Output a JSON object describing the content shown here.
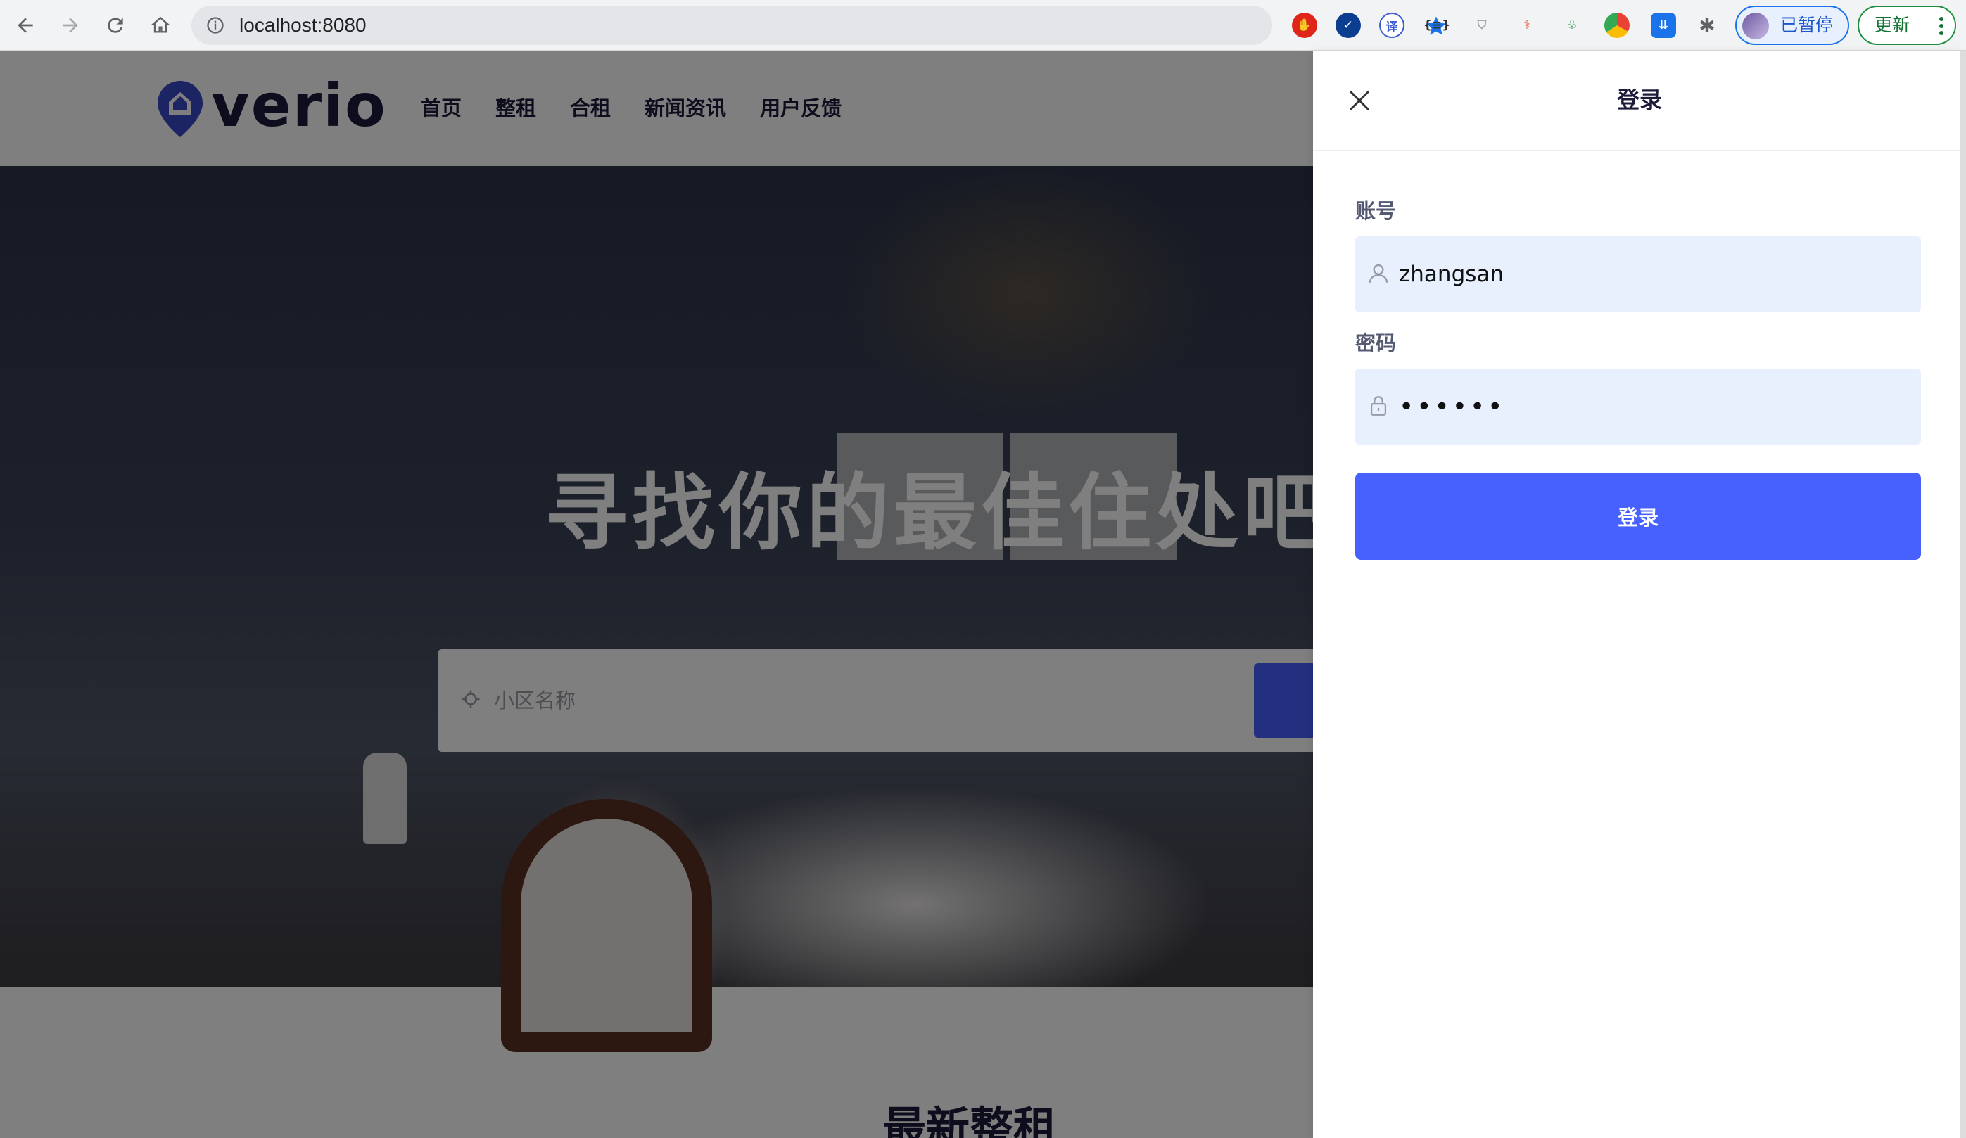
{
  "browser": {
    "url": "localhost:8080",
    "profile_label": "已暂停",
    "update_label": "更新",
    "extensions": [
      "adblock-icon",
      "check-icon",
      "translate-icon",
      "json-icon",
      "shield-icon",
      "network-icon",
      "puzzle-green-icon",
      "chrome-color-icon",
      "download-icon",
      "extensions-icon"
    ]
  },
  "site": {
    "logo_text": "verio",
    "nav": [
      "首页",
      "整租",
      "合租",
      "新闻资讯",
      "用户反馈"
    ],
    "hero_title": "寻找你的最佳住处吧",
    "search_placeholder": "小区名称",
    "latest_title": "最新整租"
  },
  "login": {
    "title": "登录",
    "account_label": "账号",
    "account_value": "zhangsan",
    "password_label": "密码",
    "password_value": "••••••",
    "submit_label": "登录"
  },
  "colors": {
    "primary": "#4761ff",
    "input_bg": "#e8f0fe",
    "text_dark": "#1d1b3a"
  }
}
